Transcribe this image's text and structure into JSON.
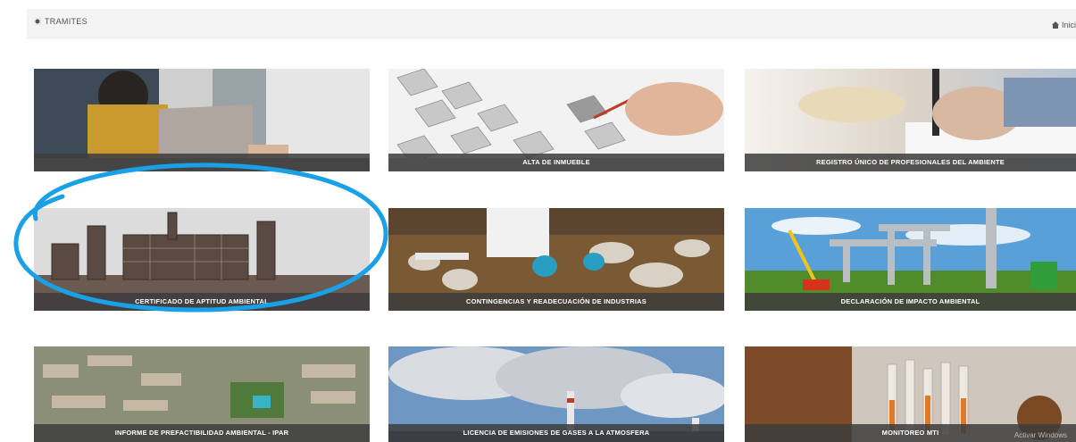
{
  "header": {
    "section_label": "TRAMITES",
    "home_label": "Inici"
  },
  "cards": [
    {
      "label": ""
    },
    {
      "label": "ALTA DE INMUEBLE"
    },
    {
      "label": "REGISTRO ÚNICO DE PROFESIONALES DEL AMBIENTE"
    },
    {
      "label": "CERTIFICADO DE APTITUD AMBIENTAL"
    },
    {
      "label": "CONTINGENCIAS Y READECUACIÓN DE INDUSTRIAS"
    },
    {
      "label": "DECLARACIÓN DE IMPACTO AMBIENTAL"
    },
    {
      "label": "INFORME DE PREFACTIBILIDAD AMBIENTAL - IPAR"
    },
    {
      "label": "LICENCIA DE EMISIONES DE GASES A LA ATMOSFERA"
    },
    {
      "label": "MONITOREO MTI"
    }
  ],
  "watermark": "Activar Windows",
  "highlight_color": "#1aa0e6"
}
